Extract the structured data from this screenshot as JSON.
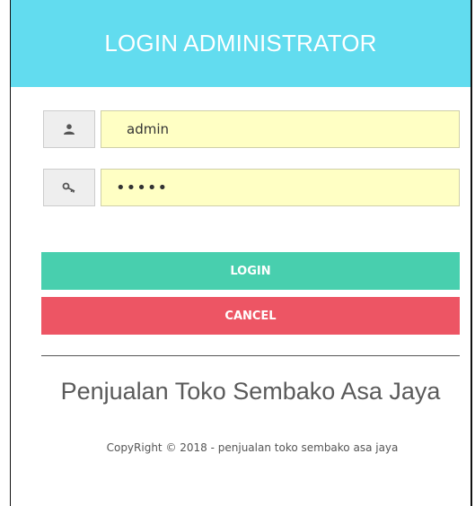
{
  "header": {
    "title": "LOGIN ADMINISTRATOR"
  },
  "form": {
    "username": {
      "value": "admin",
      "icon": "user-icon"
    },
    "password": {
      "value": "•••••",
      "icon": "key-icon"
    }
  },
  "buttons": {
    "login": "LOGIN",
    "cancel": "CANCEL"
  },
  "footer": {
    "app_name": "Penjualan Toko Sembako Asa Jaya",
    "copyright": "CopyRight © 2018 - penjualan toko sembako asa jaya"
  },
  "colors": {
    "header_bg": "#62dcef",
    "field_bg": "#ffffc4",
    "login_button": "#48cfae",
    "cancel_button": "#ed5564"
  }
}
